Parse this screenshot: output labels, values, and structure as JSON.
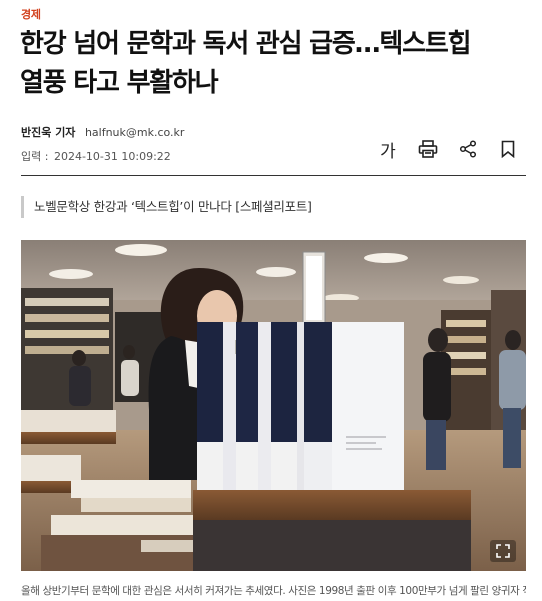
{
  "article": {
    "category": "경제",
    "headline_line1": "한강 넘어 문학과 독서 관심 급증…텍스트힙",
    "headline_line2": "열풍 타고 부활하나",
    "author": "반진욱 기자",
    "email": "halfnuk@mk.co.kr",
    "date_label": "입력 :",
    "date_value": "2024-10-31 10:09:22",
    "subhead": "노벨문학상 한강과 ‘텍스트힙’이 만나다 [스페셜리포트]"
  },
  "toolbar": {
    "font_size_glyph": "가"
  },
  "photo": {
    "caption": "올해 상반기부터 문학에 대한 관심은 서서히 커져가는 추세였다. 사진은 1998년 출판 이후 100만부가 넘게 팔린 양귀자 작가의 ‘모순’ (매경 DB)"
  },
  "colors": {
    "category": "#d2421f",
    "rule": "#333333",
    "subhead_bar": "#c9c9c9"
  }
}
